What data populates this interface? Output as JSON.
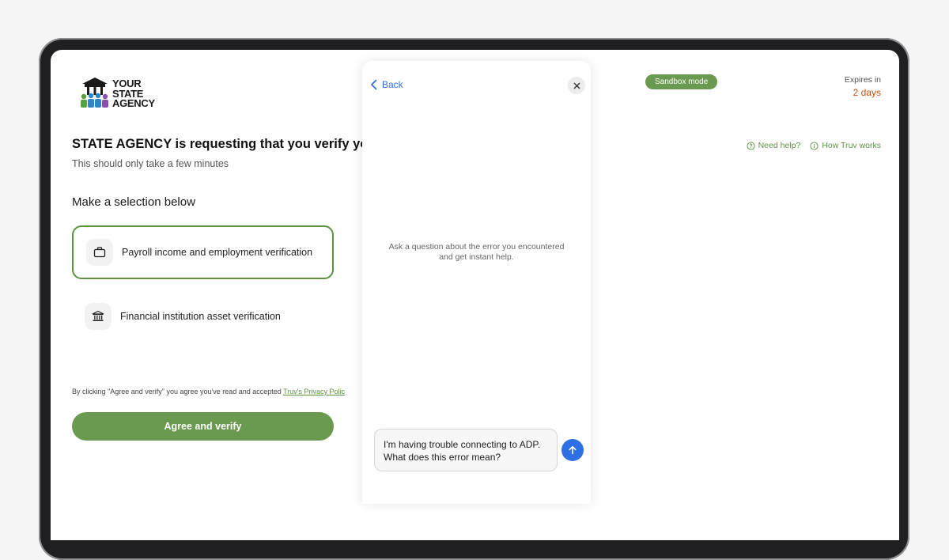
{
  "brand": {
    "logo_line1": "YOUR",
    "logo_line2": "STATE",
    "logo_line3": "AGENCY"
  },
  "header": {
    "title": "STATE AGENCY is requesting that you verify your",
    "subtitle": "This should only take a few minutes",
    "sandbox_badge": "Sandbox mode",
    "expires_label": "Expires in",
    "expires_value": "2 days",
    "need_help": "Need help?",
    "how_it_works": "How Truv works"
  },
  "selection": {
    "heading": "Make a selection below",
    "options": [
      {
        "label": "Payroll income and employment verification",
        "icon": "briefcase-icon",
        "selected": true
      },
      {
        "label": "Financial institution asset verification",
        "icon": "bank-icon",
        "selected": false
      }
    ]
  },
  "consent": {
    "text": "By clicking \"Agree and verify\" you agree you've read and accepted ",
    "link": "Truv's Privacy Polic"
  },
  "cta": {
    "label": "Agree and verify"
  },
  "help_panel": {
    "back_label": "Back",
    "prompt_line1": "Ask a question about the error you encountered",
    "prompt_line2": "and get instant help.",
    "message_line1": "I'm having trouble connecting to ADP.",
    "message_line2": "What does this error mean?"
  },
  "colors": {
    "accent_green": "#6a9a4f",
    "link_blue": "#3a6fd8",
    "send_blue": "#2f6fe4",
    "expires_orange": "#c0521a"
  }
}
